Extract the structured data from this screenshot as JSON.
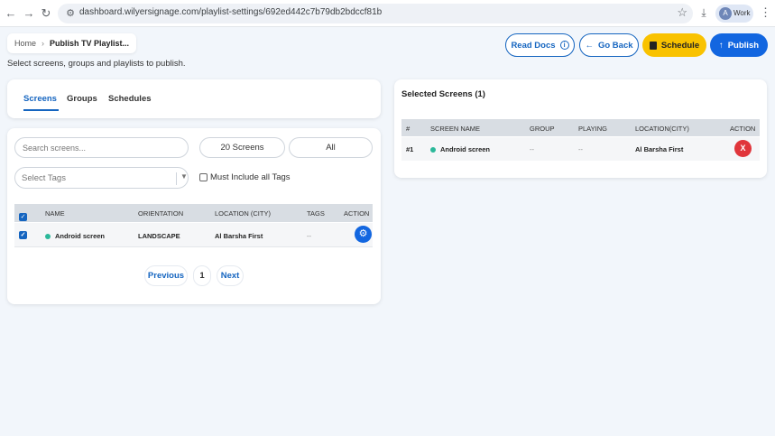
{
  "browser": {
    "url": "dashboard.wilyersignage.com/playlist-settings/692ed442c7b79db2bdccf81b",
    "profile_initial": "A",
    "profile_label": "Work"
  },
  "breadcrumb": {
    "home": "Home",
    "current": "Publish TV Playlist..."
  },
  "subtitle": "Select screens, groups and playlists to publish.",
  "header_buttons": {
    "read_docs": "Read Docs",
    "go_back": "Go Back",
    "schedule": "Schedule",
    "publish": "Publish"
  },
  "tabs": [
    {
      "label": "Screens",
      "active": true
    },
    {
      "label": "Groups",
      "active": false
    },
    {
      "label": "Schedules",
      "active": false
    }
  ],
  "screens_panel": {
    "search_placeholder": "Search screens...",
    "count_label": "20 Screens",
    "filter_label": "All",
    "tags_placeholder": "Select Tags",
    "must_include_label": "Must Include all Tags",
    "columns": [
      "NAME",
      "ORIENTATION",
      "LOCATION (CITY)",
      "TAGS",
      "ACTION"
    ],
    "rows": [
      {
        "name": "Android screen",
        "orientation": "LANDSCAPE",
        "location": "Al Barsha First",
        "tags": "--"
      }
    ],
    "pagination": {
      "prev": "Previous",
      "page": "1",
      "next": "Next"
    }
  },
  "selected_panel": {
    "title": "Selected Screens (1)",
    "columns": [
      "#",
      "SCREEN NAME",
      "GROUP",
      "PLAYING",
      "LOCATION(CITY)",
      "ACTION"
    ],
    "rows": [
      {
        "index": "#1",
        "name": "Android screen",
        "group": "--",
        "playing": "--",
        "location": "Al Barsha First",
        "remove": "X"
      }
    ]
  },
  "colors": {
    "primary": "#1266e0",
    "schedule": "#f9c200",
    "remove": "#e0353b",
    "status_online": "#2bb89a"
  }
}
